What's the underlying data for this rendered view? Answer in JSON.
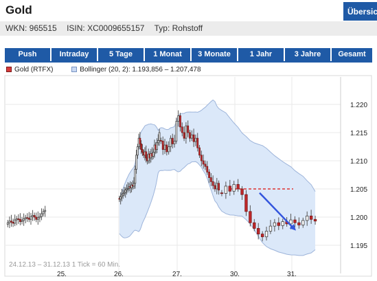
{
  "header": {
    "title": "Gold",
    "overview_label": "Übersicht"
  },
  "info": {
    "wkn": "WKN: 965515",
    "isin": "ISIN: XC0009655157",
    "typ": "Typ: Rohstoff"
  },
  "tabs": [
    {
      "label": "Push",
      "active": false
    },
    {
      "label": "Intraday",
      "active": false
    },
    {
      "label": "5 Tage",
      "active": true
    },
    {
      "label": "1 Monat",
      "active": false
    },
    {
      "label": "3 Monate",
      "active": false
    },
    {
      "label": "1 Jahr",
      "active": false
    },
    {
      "label": "3 Jahre",
      "active": false
    },
    {
      "label": "Gesamt",
      "active": false
    }
  ],
  "legend": {
    "gold": "Gold (RTFX)",
    "bollinger": "Bollinger (20, 2): 1.193,856 – 1.207,478"
  },
  "colors": {
    "accent": "#1f5aa6",
    "candle_up": "#444444",
    "candle_down": "#c0282a",
    "band_fill": "#dbe8f9",
    "band_line": "#9db4da",
    "arrow": "#3355dd",
    "support_line": "#e03030"
  },
  "chart_data": {
    "type": "candlestick",
    "note": "24.12.13 – 31.12.13   1 Tick = 60 Min.",
    "x_tick_labels": [
      "25.",
      "26.",
      "27.",
      "30.",
      "31."
    ],
    "y_tick_labels": [
      "1.220",
      "1.215",
      "1.210",
      "1.205",
      "1.200",
      "1.195"
    ],
    "y_ticks": [
      1220,
      1215,
      1210,
      1205,
      1200,
      1195
    ],
    "ylim": [
      1192.5,
      1222.5
    ],
    "grid": true,
    "bollinger": {
      "period": 20,
      "sigma": 2,
      "upper_last": 1207.478,
      "lower_last": 1193.856
    },
    "sessions": [
      {
        "day": "24.",
        "closes": [
          1199.0,
          1199.3,
          1199.1,
          1198.9,
          1199.5,
          1199.7,
          1199.6,
          1199.2,
          1199.4,
          1199.7,
          1199.9,
          1199.8,
          1199.6,
          1200.1,
          1200.3,
          1200.0,
          1199.6,
          1199.9,
          1200.1,
          1200.6,
          1201.0,
          1201.2
        ]
      },
      {
        "day": "26.",
        "closes": [
          1203.2,
          1203.6,
          1203.9,
          1204.2,
          1204.4,
          1204.8,
          1205.0,
          1205.1,
          1205.4,
          1205.2,
          1205.7,
          1205.5,
          1206.0,
          1208.5,
          1211.0,
          1212.5,
          1214.0,
          1213.0,
          1212.0,
          1211.5,
          1211.0,
          1211.6,
          1210.5,
          1210.0,
          1211.2,
          1210.5,
          1211.3,
          1210.8,
          1211.5,
          1212.8,
          1212.0,
          1213.2,
          1213.6,
          1215.0
        ]
      },
      {
        "day": "27.",
        "closes": [
          1213.5,
          1212.0,
          1212.8,
          1211.6,
          1212.5,
          1214.0,
          1213.0,
          1213.5,
          1217.0,
          1218.0,
          1216.0,
          1215.0,
          1214.0,
          1216.2,
          1215.0,
          1214.0,
          1214.6,
          1213.4,
          1214.0,
          1212.3,
          1211.0,
          1210.0,
          1209.4,
          1209.0,
          1208.0,
          1207.0,
          1206.3,
          1205.6,
          1205.0,
          1206.0,
          1204.8
        ]
      },
      {
        "day": "30.",
        "closes": [
          1204.2,
          1205.5,
          1204.6,
          1205.8,
          1205.0,
          1204.0,
          1201.0,
          1199.0,
          1198.0,
          1197.0,
          1196.5,
          1197.5,
          1198.4,
          1199.0,
          1198.5,
          1199.2,
          1198.8,
          1199.5,
          1199.0,
          1198.6,
          1199.4,
          1200.2,
          1199.6,
          1199.3
        ]
      }
    ]
  }
}
